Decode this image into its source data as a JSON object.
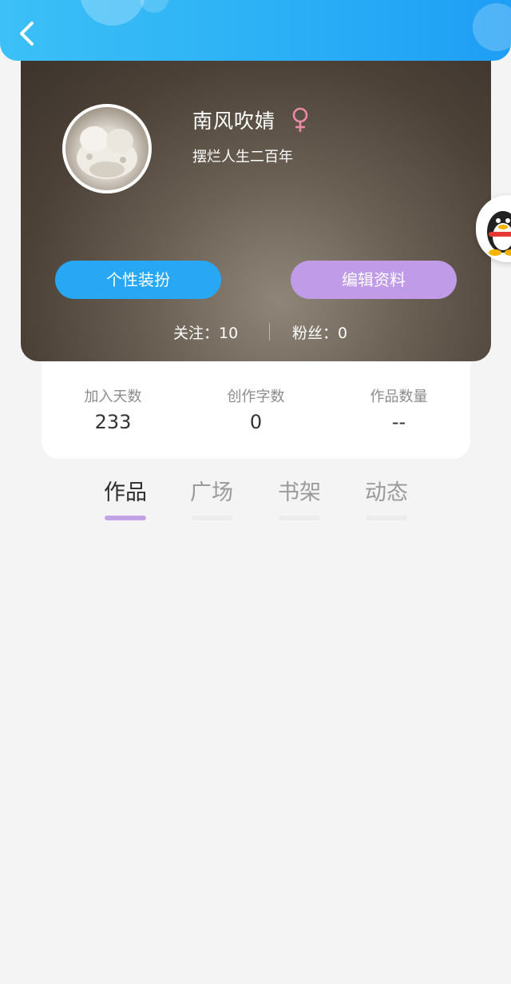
{
  "header": {
    "back_icon": "chevron-left-icon",
    "bg_color": "#2bb0f6"
  },
  "profile": {
    "username": "南风吹婧",
    "gender_icon": "female-icon",
    "gender_color": "#e98aa6",
    "bio": "摆烂人生二百年",
    "buttons": {
      "dress_up": "个性装扮",
      "edit_profile": "编辑资料"
    },
    "following_label": "关注：10",
    "fans_label": "粉丝：0"
  },
  "stats": [
    {
      "label": "加入天数",
      "value": "233"
    },
    {
      "label": "创作字数",
      "value": "0"
    },
    {
      "label": "作品数量",
      "value": "--"
    }
  ],
  "tabs": [
    {
      "label": "作品",
      "active": true
    },
    {
      "label": "广场",
      "active": false
    },
    {
      "label": "书架",
      "active": false
    },
    {
      "label": "动态",
      "active": false
    }
  ],
  "colors": {
    "primary_blue": "#27a7f4",
    "accent_purple": "#c09be8",
    "tab_underline": "#c2a3e6"
  },
  "floating": {
    "icon": "qq-penguin-icon"
  }
}
